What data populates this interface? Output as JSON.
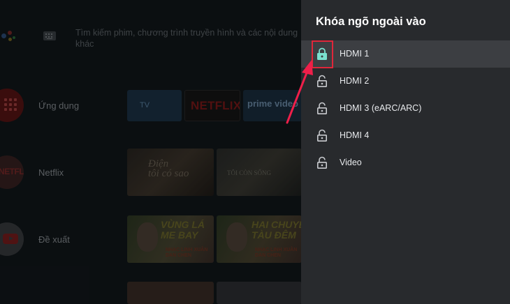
{
  "home": {
    "search_text": "Tìm kiếm phim, chương trình truyền hình và các nội dung khác",
    "rows": [
      {
        "label": "Ứng dụng"
      },
      {
        "label": "Netflix"
      },
      {
        "label": "Đề xuất"
      }
    ],
    "app_tiles": {
      "tv": "TV",
      "netflix": "NETFLIX",
      "prime": "prime video"
    },
    "netflix_row": {
      "poster_1": "Điện\ntôi có sao",
      "poster_2": "TÔI CÒN SỐNG"
    },
    "recommended_row": {
      "thumb_1_title": "VÙNG LÁ\nME BAY",
      "thumb_1_sub": "NHẠC LINH XUÂN\nDAN CHEN",
      "thumb_2_title": "HAI CHUYẾN\nTÀU ĐÊM",
      "thumb_2_sub": "NHẠC LINH XUÂN\nDAN CHEN"
    }
  },
  "panel": {
    "title": "Khóa ngõ ngoài vào",
    "options": [
      {
        "label": "HDMI 1",
        "state": "locked",
        "focused": true
      },
      {
        "label": "HDMI 2",
        "state": "unlocked",
        "focused": false
      },
      {
        "label": "HDMI 3 (eARC/ARC)",
        "state": "unlocked",
        "focused": false
      },
      {
        "label": "HDMI 4",
        "state": "unlocked",
        "focused": false
      },
      {
        "label": "Video",
        "state": "unlocked",
        "focused": false
      }
    ]
  },
  "icons": {
    "locked": "lock-closed-icon",
    "unlocked": "lock-open-icon",
    "assistant": "google-assistant-icon",
    "keyboard": "keyboard-icon",
    "apps": "apps-grid-icon",
    "netflix": "netflix-icon",
    "youtube": "youtube-icon"
  },
  "colors": {
    "panel_bg": "#282a2d",
    "focus_bg": "#3c3e42",
    "locked_icon": "#7be0d0",
    "unlocked_icon": "#c9cbcf",
    "annotation": "#e0263a"
  }
}
